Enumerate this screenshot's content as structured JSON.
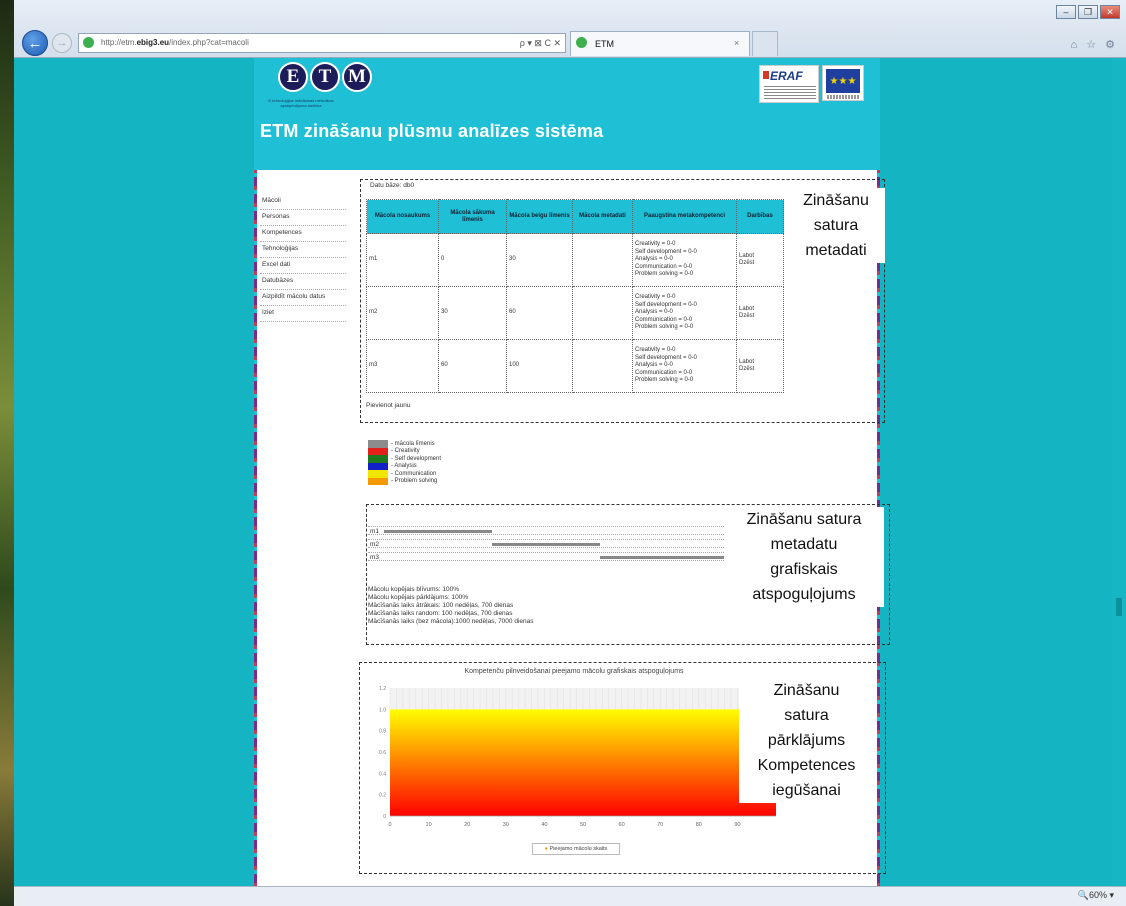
{
  "browser": {
    "url_prefix": "http://etm.",
    "url_domain": "ebig3.eu",
    "url_path": "/index.php?cat=macoli",
    "addr_tools": "ρ ▾ ⊠ C ✕",
    "tab_title": "ETM",
    "tab_close": "×",
    "zoom": "🔍60%  ▾",
    "window_buttons": [
      "–",
      "❐",
      "✕"
    ],
    "toolbar_icons": "⌂ ☆ ⚙"
  },
  "site": {
    "logo_letters": [
      "E",
      "T",
      "M"
    ],
    "tagline": "E-tehnoloģijas mācīšanas metodikas apstiprinājuma sistēma",
    "title": "ETM zināšanu plūsmu analīzes sistēma",
    "eraf_label": "ERAF",
    "eu_stars": "★★★"
  },
  "sidebar": {
    "items": [
      "Mācoli",
      "Personas",
      "Kompetences",
      "Tehnoloģijas",
      "Excel dati",
      "Datubāzes",
      "Aizpildīt mācolu datus",
      "Iziet"
    ]
  },
  "annotations": {
    "section1": [
      "Zināšanu",
      "satura",
      "metadati"
    ],
    "section2": [
      "Zināšanu satura",
      "metadatu",
      "grafiskais",
      "atspoguļojums"
    ],
    "section3": [
      "Zināšanu",
      "satura",
      "pārklājums",
      "Kompetences",
      "iegūšanai"
    ]
  },
  "table": {
    "db_label": "Datu bāze: db0",
    "headers": [
      "Mācola nosaukums",
      "Mācola sākuma līmenis",
      "Mācola beigu līmenis",
      "Mācola metadati",
      "Paaugstina metakompetenci",
      "Darbības"
    ],
    "rows": [
      {
        "name": "m1",
        "start": "0",
        "end": "30",
        "meta": "",
        "competences": [
          "Creativity = 0-0",
          "Self development = 0-0",
          "Analysis = 0-0",
          "Communication = 0-0",
          "Problem solving = 0-0"
        ],
        "actions": [
          "Labot",
          "Dzēst"
        ]
      },
      {
        "name": "m2",
        "start": "30",
        "end": "60",
        "meta": "",
        "competences": [
          "Creativity = 0-0",
          "Self development = 0-0",
          "Analysis = 0-0",
          "Communication = 0-0",
          "Problem solving = 0-0"
        ],
        "actions": [
          "Labot",
          "Dzēst"
        ]
      },
      {
        "name": "m3",
        "start": "60",
        "end": "100",
        "meta": "",
        "competences": [
          "Creativity = 0-0",
          "Self development = 0-0",
          "Analysis = 0-0",
          "Communication = 0-0",
          "Problem solving = 0-0"
        ],
        "actions": [
          "Labot",
          "Dzēst"
        ]
      }
    ],
    "add_link": "Pievienot jaunu"
  },
  "legend": [
    {
      "label": "- mācola līmenis",
      "color": "#8c8c8c"
    },
    {
      "label": "- Creativity",
      "color": "#e3201b"
    },
    {
      "label": "- Self development",
      "color": "#1f7a1f"
    },
    {
      "label": "- Analysis",
      "color": "#1220c8"
    },
    {
      "label": "- Communication",
      "color": "#f2e600"
    },
    {
      "label": "- Problem solving",
      "color": "#f29a00"
    }
  ],
  "progress": {
    "rows": [
      {
        "label": "m1",
        "start": 0,
        "end": 30
      },
      {
        "label": "m2",
        "start": 30,
        "end": 60
      },
      {
        "label": "m3",
        "start": 60,
        "end": 100
      }
    ],
    "stats": [
      "Mācolu kopējais blīvums: 100%",
      "Mācolu kopējais pārklājums: 100%",
      "Mācīšanās laiks ātrākais: 100 nedēļas, 700 dienas",
      "Mācīšanās laiks random: 100 nedēļas, 700 dienas",
      "Mācīšanās laiks (bez mācola):1000 nedēļas, 7000 dienas"
    ]
  },
  "chart_data": {
    "type": "area",
    "title": "Kompetenču pilnveidošanai pieejamo mācolu grafiskais atspoguļojums",
    "xlabel": "",
    "ylabel": "",
    "xlim": [
      0,
      100
    ],
    "ylim": [
      0,
      1.2
    ],
    "x_ticks": [
      "0",
      "10",
      "20",
      "30",
      "40",
      "50",
      "60",
      "70",
      "80",
      "90"
    ],
    "y_ticks": [
      "0",
      "0.2",
      "0.4",
      "0.6",
      "0.8",
      "1.0",
      "1.2"
    ],
    "series": [
      {
        "name": "Pieejamo mācolu skaits",
        "x": [
          0,
          100
        ],
        "values": [
          1,
          1
        ]
      }
    ],
    "legend_position": "bottom",
    "gradient": [
      "#ffff00",
      "#ff0000"
    ]
  }
}
